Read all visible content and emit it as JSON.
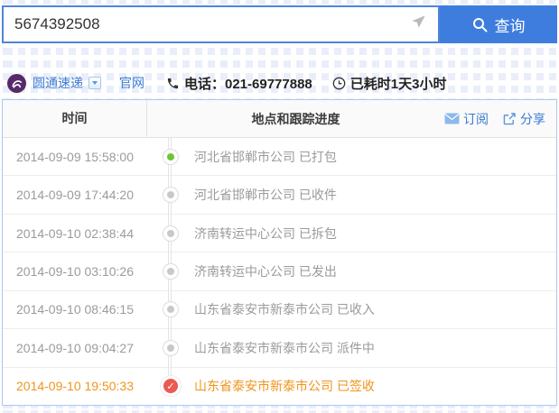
{
  "search": {
    "value": "5674392508",
    "button_label": "查询"
  },
  "courier": {
    "name": "圆通速递",
    "official_site": "官网",
    "phone": "电话：021-69777888",
    "elapsed": "已耗时1天3小时"
  },
  "table": {
    "headers": {
      "time": "时间",
      "progress": "地点和跟踪进度"
    },
    "actions": {
      "subscribe": "订阅",
      "share": "分享"
    },
    "rows": [
      {
        "time": "2014-09-09 15:58:00",
        "text": "河北省邯郸市公司 已打包",
        "dot": "green"
      },
      {
        "time": "2014-09-09 17:44:20",
        "text": "河北省邯郸市公司 已收件",
        "dot": "gray"
      },
      {
        "time": "2014-09-10 02:38:44",
        "text": "济南转运中心公司 已拆包",
        "dot": "gray"
      },
      {
        "time": "2014-09-10 03:10:26",
        "text": "济南转运中心公司 已发出",
        "dot": "gray"
      },
      {
        "time": "2014-09-10 08:46:15",
        "text": "山东省泰安市新泰市公司 已收入",
        "dot": "gray"
      },
      {
        "time": "2014-09-10 09:04:27",
        "text": "山东省泰安市新泰市公司 派件中",
        "dot": "gray"
      },
      {
        "time": "2014-09-10 19:50:33",
        "text": "山东省泰安市新泰市公司 已签收",
        "dot": "check",
        "highlight": true
      }
    ]
  },
  "icons": {
    "check": "✓",
    "search": "magnifier-icon",
    "send": "paper-plane-icon",
    "phone": "phone-receiver-icon",
    "clock": "clock-icon",
    "subscribe": "envelope-icon",
    "share": "share-icon"
  },
  "colors": {
    "accent_blue": "#3e7dde",
    "link_blue": "#3a7ad2",
    "table_border": "#aac9ee",
    "green_dot": "#6bc72f",
    "gray_dot": "#c8c8c8",
    "delivered_red": "#ea5a52",
    "highlight_orange": "#f0941d",
    "logo_purple": "#582a6a"
  }
}
